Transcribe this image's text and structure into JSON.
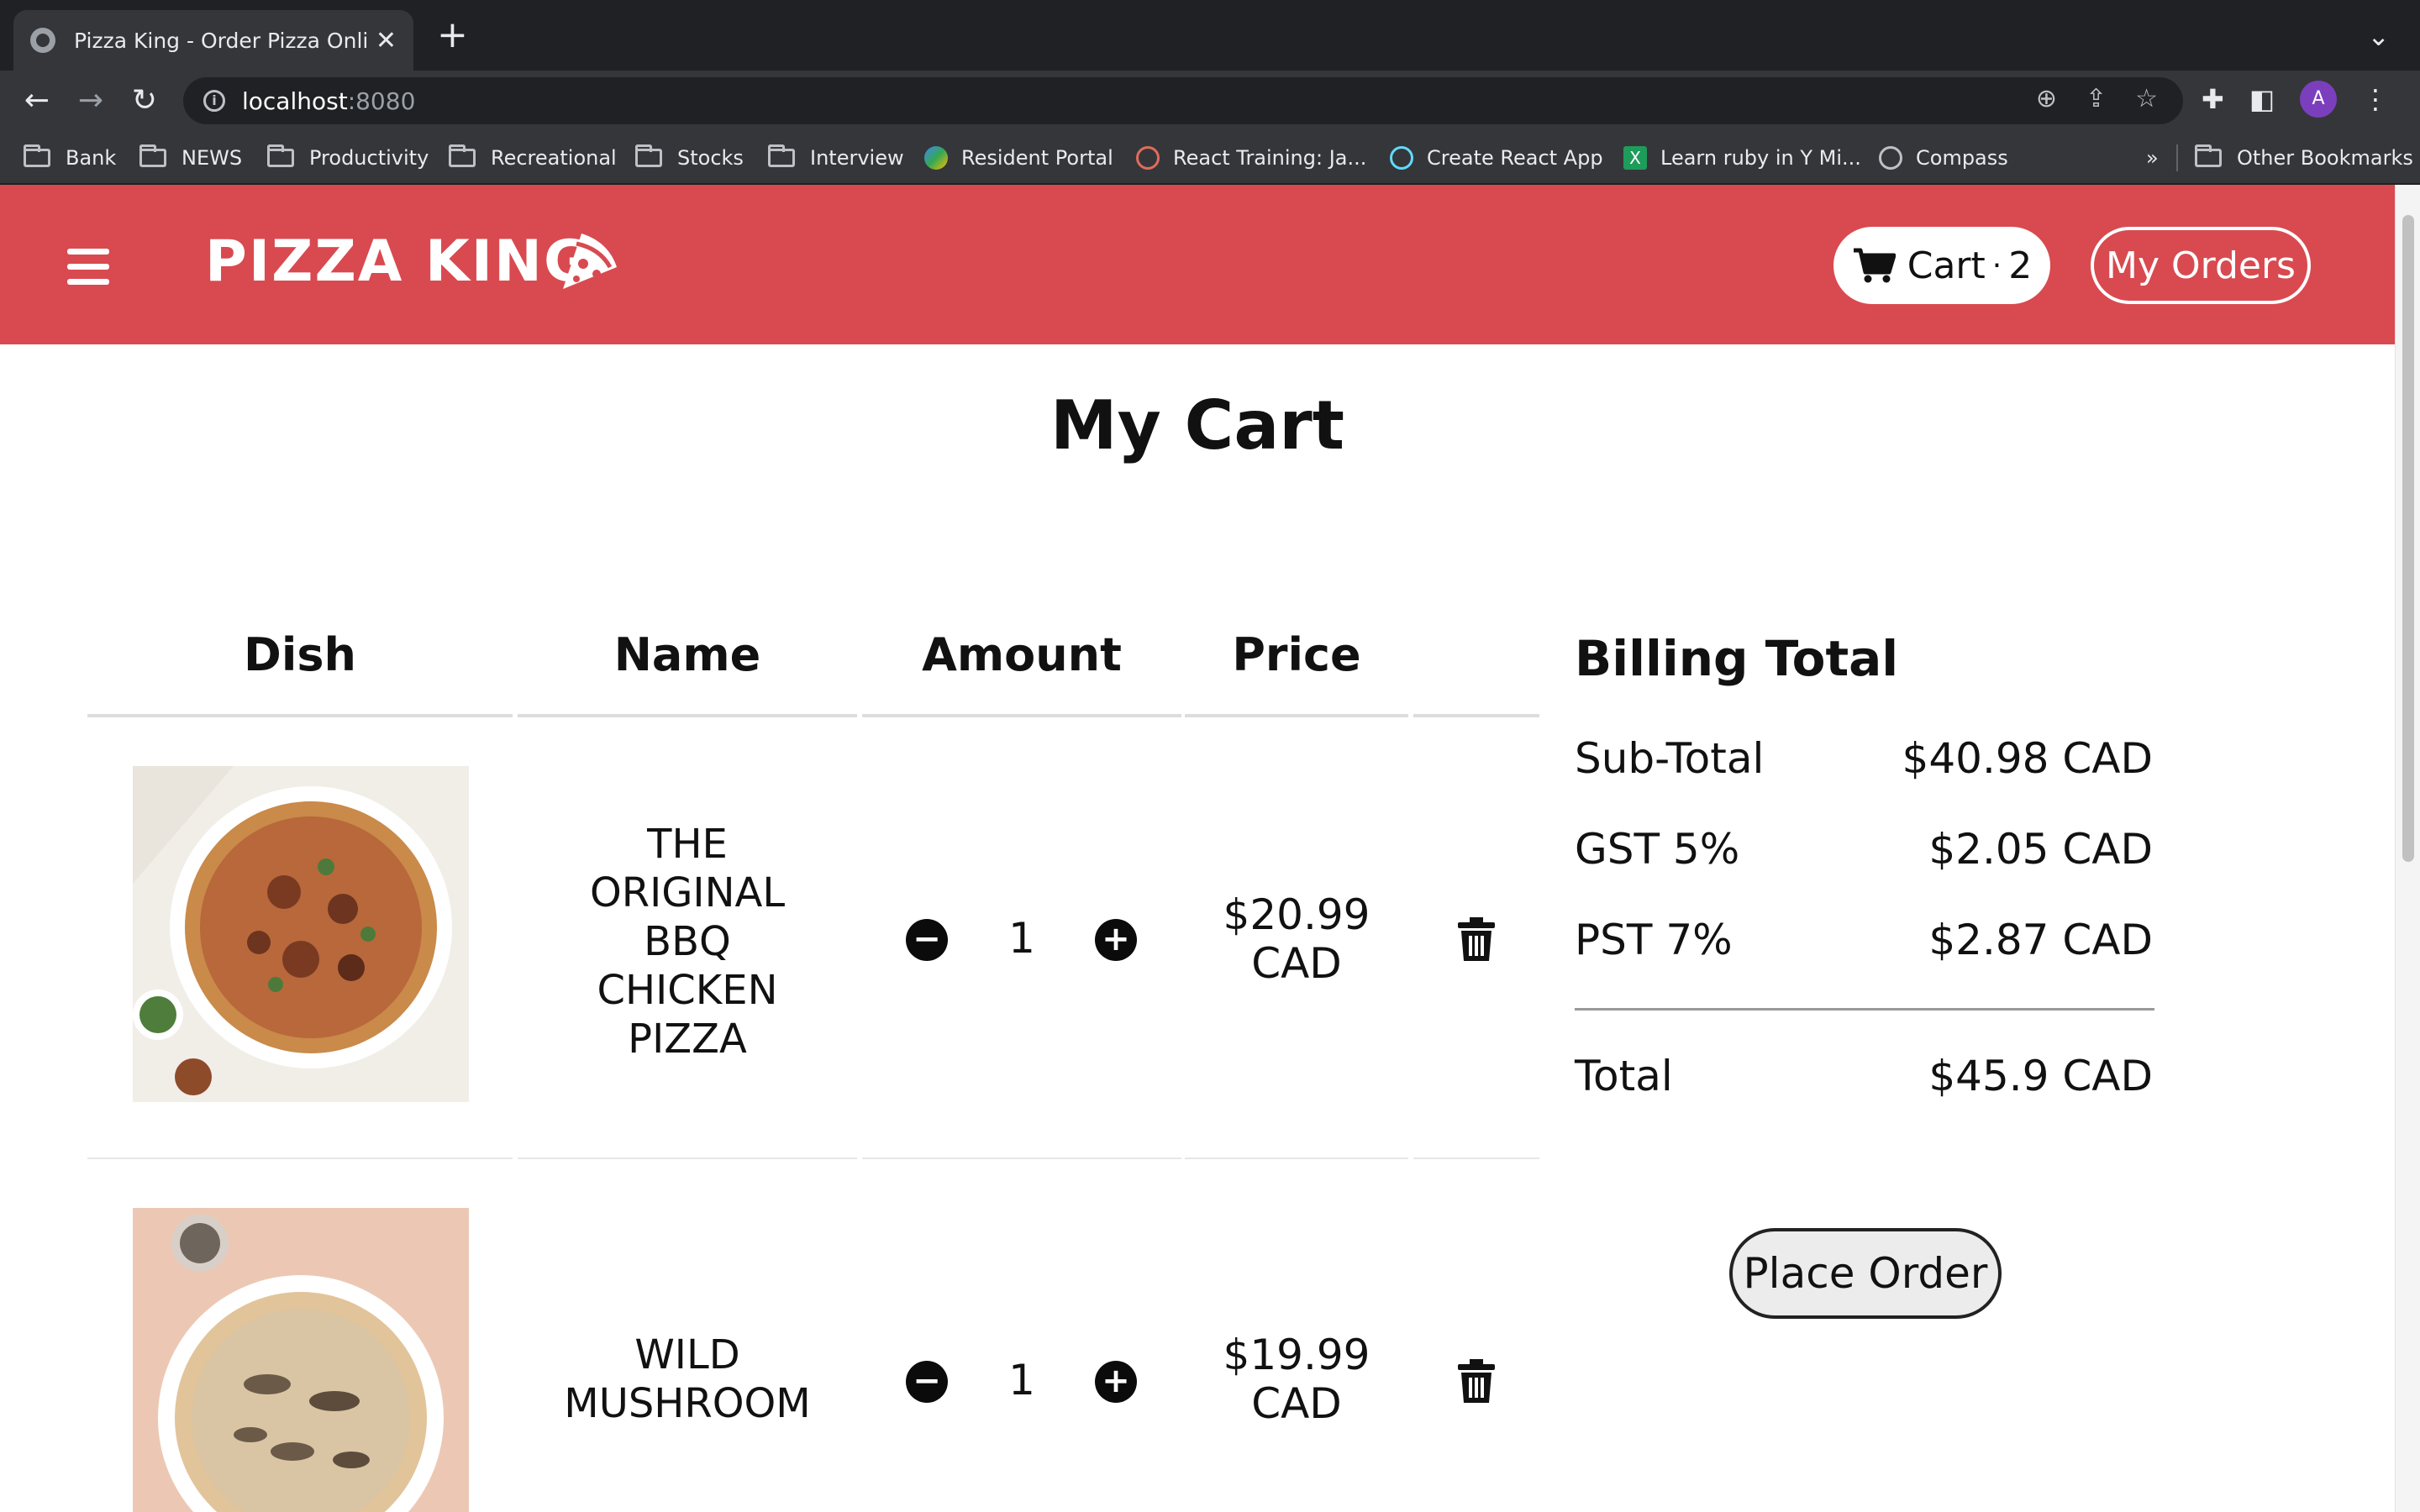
{
  "browser": {
    "tab_title": "Pizza King - Order Pizza Online",
    "url_host": "localhost",
    "url_port": ":8080",
    "profile_initial": "A",
    "bookmarks": [
      {
        "label": "Bank",
        "icon": "folder-icon"
      },
      {
        "label": "NEWS",
        "icon": "folder-icon"
      },
      {
        "label": "Productivity",
        "icon": "folder-icon"
      },
      {
        "label": "Recreational",
        "icon": "folder-icon"
      },
      {
        "label": "Stocks",
        "icon": "folder-icon"
      },
      {
        "label": "Interview",
        "icon": "folder-icon"
      },
      {
        "label": "Resident Portal",
        "icon": "drive-icon"
      },
      {
        "label": "React Training: Ja...",
        "icon": "eye-icon"
      },
      {
        "label": "Create React App",
        "icon": "react-icon"
      },
      {
        "label": "Learn ruby in Y Mi...",
        "icon": "x-icon"
      },
      {
        "label": "Compass",
        "icon": "compass-icon"
      }
    ],
    "overflow_label": "»",
    "other_bookmarks": "Other Bookmarks"
  },
  "header": {
    "logo": "PIZZA KING",
    "cart_label": "Cart",
    "cart_sep": "·",
    "cart_count": "2",
    "orders_label": "My Orders",
    "brand_color": "#d84a50"
  },
  "page": {
    "title": "My Cart",
    "columns": [
      "Dish",
      "Name",
      "Amount",
      "Price"
    ]
  },
  "cart_items": [
    {
      "name_lines": [
        "THE",
        "ORIGINAL",
        "BBQ",
        "CHICKEN",
        "PIZZA"
      ],
      "amount": "1",
      "price_lines": [
        "$20.99",
        "CAD"
      ]
    },
    {
      "name_lines": [
        "WILD",
        "MUSHROOM"
      ],
      "amount": "1",
      "price_lines": [
        "$19.99",
        "CAD"
      ]
    }
  ],
  "billing": {
    "title": "Billing Total",
    "rows": [
      {
        "label": "Sub-Total",
        "value": "$40.98 CAD"
      },
      {
        "label": "GST 5%",
        "value": "$2.05 CAD"
      },
      {
        "label": "PST 7%",
        "value": "$2.87 CAD"
      }
    ],
    "total_label": "Total",
    "total_value": "$45.9 CAD",
    "place_order": "Place Order"
  }
}
